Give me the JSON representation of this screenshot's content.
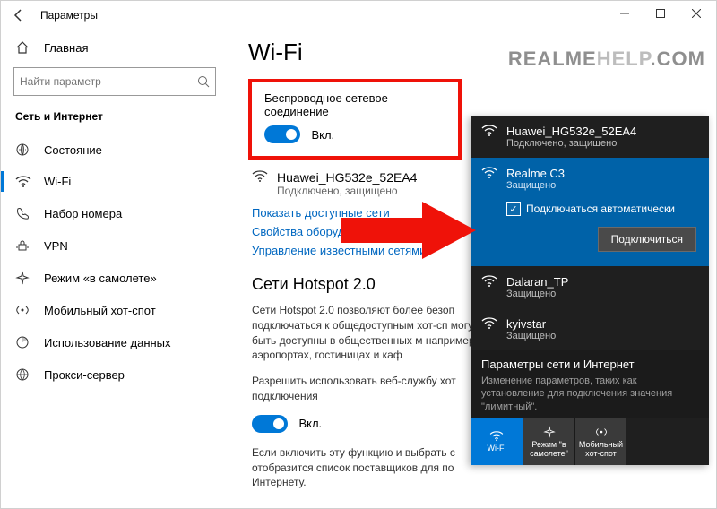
{
  "window": {
    "title": "Параметры"
  },
  "watermark": {
    "a": "REALME",
    "b": "HELP",
    "c": ".COM"
  },
  "sidebar": {
    "home": "Главная",
    "search_placeholder": "Найти параметр",
    "section": "Сеть и Интернет",
    "items": [
      {
        "label": "Состояние"
      },
      {
        "label": "Wi-Fi"
      },
      {
        "label": "Набор номера"
      },
      {
        "label": "VPN"
      },
      {
        "label": "Режим «в самолете»"
      },
      {
        "label": "Мобильный хот-спот"
      },
      {
        "label": "Использование данных"
      },
      {
        "label": "Прокси-сервер"
      }
    ]
  },
  "main": {
    "h1": "Wi-Fi",
    "wireless_label": "Беспроводное сетевое соединение",
    "toggle_on": "Вкл.",
    "connected_name": "Huawei_HG532e_52EA4",
    "connected_status": "Подключено, защищено",
    "link_show": "Показать доступные сети",
    "link_hw": "Свойства оборудов",
    "link_manage": "Управление известными сетями",
    "h2": "Сети Hotspot 2.0",
    "p1": "Сети Hotspot 2.0 позволяют более безоп подключаться к общедоступным хот-сп могут быть доступны в общественных м например аэропортах, гостиницах и каф",
    "p2": "Разрешить использовать веб-службу хот подключения",
    "p3": "Если включить эту функцию и выбрать с отобразится список поставщиков для по Интернету."
  },
  "flyout": {
    "nets": [
      {
        "name": "Huawei_HG532e_52EA4",
        "status": "Подключено, защищено"
      },
      {
        "name": "Realme C3",
        "status": "Защищено"
      },
      {
        "name": "Dalaran_TP",
        "status": "Защищено"
      },
      {
        "name": "kyivstar",
        "status": "Защищено"
      }
    ],
    "auto": "Подключаться автоматически",
    "connect": "Подключиться",
    "footer_title": "Параметры сети и Интернет",
    "footer_sub": "Изменение параметров, таких как установление для подключения значения \"лимитный\".",
    "icons": [
      {
        "label": "Wi-Fi"
      },
      {
        "label": "Режим \"в самолете\""
      },
      {
        "label": "Мобильный хот-спот"
      }
    ]
  }
}
